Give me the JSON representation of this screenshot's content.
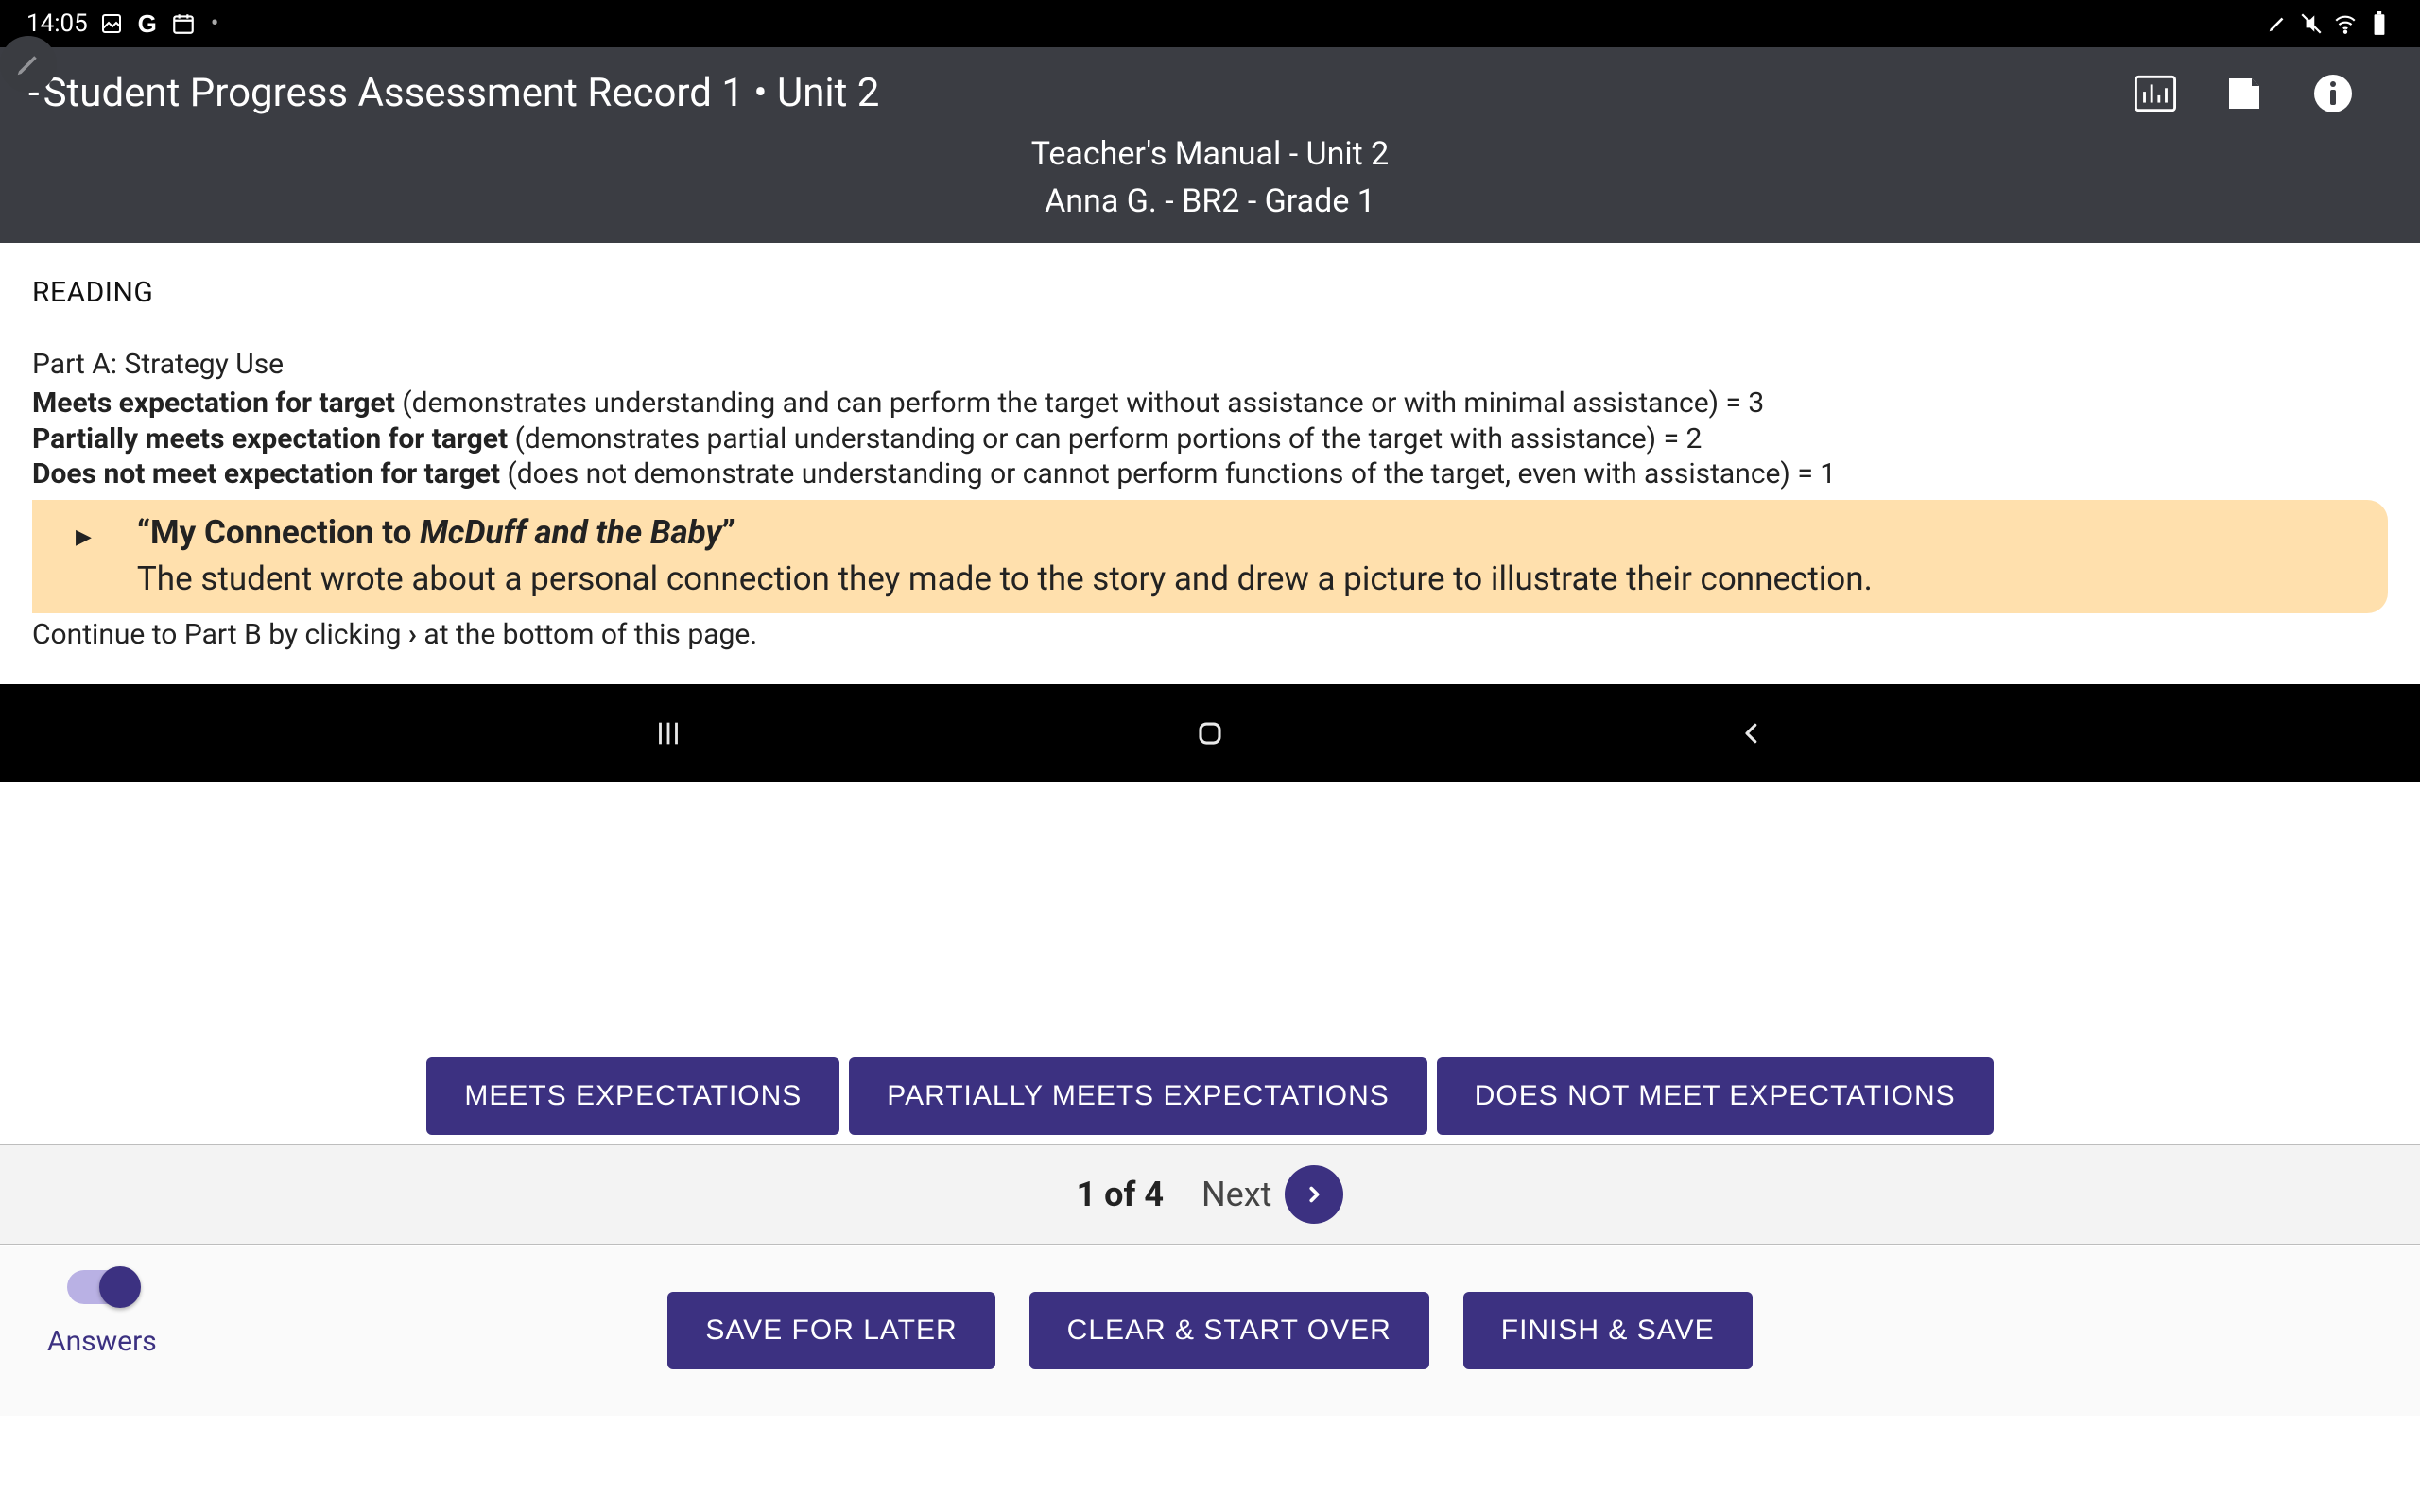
{
  "status": {
    "time": "14:05",
    "dot": "•"
  },
  "header": {
    "title_prefix": "- ",
    "title": "Student Progress Assessment Record 1 • Unit 2",
    "subtitle": "Teacher's Manual - Unit 2",
    "student_line": "Anna  G. - BR2 - Grade 1"
  },
  "content": {
    "section": "READING",
    "part_label": "Part A: Strategy Use",
    "rubric": {
      "meets": {
        "label": "Meets expectation for target",
        "desc": " (demonstrates understanding and can perform the target without assistance or with minimal assistance) = 3"
      },
      "partial": {
        "label": "Partially meets expectation for target",
        "desc": " (demonstrates partial understanding or can perform portions of the target with assistance) = 2"
      },
      "not": {
        "label": "Does not meet expectation for target",
        "desc": " (does not demonstrate understanding or cannot perform functions of the target, even with assistance) = 1"
      }
    },
    "prompt": {
      "lead": "“My Connection to ",
      "italic": "McDuff and the Baby",
      "trail": "”",
      "body": "The student wrote about a personal connection they made to the story and drew a picture to illustrate their connection."
    },
    "continue_pre": "Continue to Part B by clicking ",
    "continue_chevron": "›",
    "continue_post": " at the bottom of this page."
  },
  "buttons": {
    "meets": "MEETS EXPECTATIONS",
    "partial": "PARTIALLY MEETS EXPECTATIONS",
    "not": "DOES NOT MEET EXPECTATIONS"
  },
  "pager": {
    "count": "1 of 4",
    "next": "Next"
  },
  "save": {
    "later": "SAVE FOR LATER",
    "clear": "CLEAR & START OVER",
    "finish": "FINISH & SAVE",
    "answers": "Answers"
  },
  "colors": {
    "primary": "#3c3181",
    "highlight": "#ffe0ad"
  }
}
